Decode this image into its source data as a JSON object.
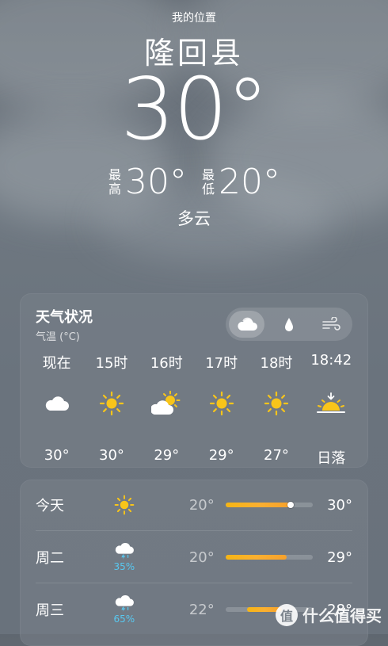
{
  "location": {
    "label": "我的位置",
    "name": "隆回县"
  },
  "current": {
    "temp": "30°",
    "high_label": "最高",
    "high": "30°",
    "low_label": "最低",
    "low": "20°",
    "condition": "多云"
  },
  "hourly_card": {
    "title": "天气状况",
    "subtitle": "气温 (°C)",
    "segments": [
      {
        "icon": "cloud-icon",
        "active": true
      },
      {
        "icon": "raindrop-icon",
        "active": false
      },
      {
        "icon": "wind-icon",
        "active": false
      }
    ],
    "hours": [
      {
        "time": "现在",
        "icon": "cloud-icon",
        "temp": "30°"
      },
      {
        "time": "15时",
        "icon": "sun-icon",
        "temp": "30°"
      },
      {
        "time": "16时",
        "icon": "partly-cloudy-icon",
        "temp": "29°"
      },
      {
        "time": "17时",
        "icon": "sun-icon",
        "temp": "29°"
      },
      {
        "time": "18时",
        "icon": "sun-icon",
        "temp": "27°"
      },
      {
        "time": "18:42",
        "icon": "sunset-icon",
        "temp": "日落"
      }
    ]
  },
  "daily": [
    {
      "day": "今天",
      "icon": "sun-icon",
      "pop": "",
      "low": "20°",
      "high": "30°",
      "bar_start": 0.0,
      "bar_end": 0.75,
      "current": 0.75
    },
    {
      "day": "周二",
      "icon": "thunderstorm-icon",
      "pop": "35%",
      "low": "20°",
      "high": "29°",
      "bar_start": 0.0,
      "bar_end": 0.7
    },
    {
      "day": "周三",
      "icon": "thunderstorm-icon",
      "pop": "65%",
      "low": "22°",
      "high": "28°",
      "bar_start": 0.25,
      "bar_end": 0.65
    }
  ],
  "watermark": {
    "badge": "值",
    "text": "什么值得买"
  }
}
